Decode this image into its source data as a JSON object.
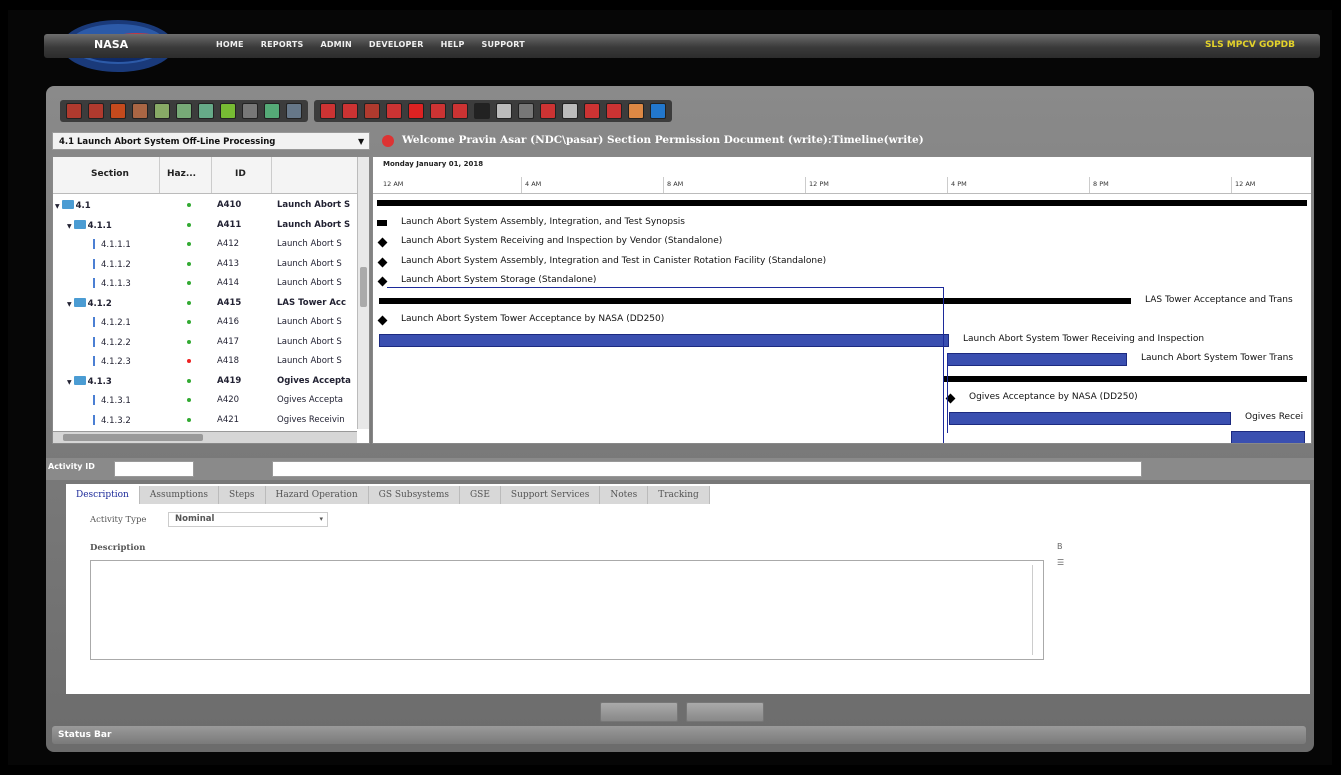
{
  "nav": {
    "logo_text": "NASA",
    "links": [
      "HOME",
      "REPORTS",
      "ADMIN",
      "DEVELOPER",
      "HELP",
      "SUPPORT"
    ],
    "app_title": "SLS MPCV GOPDB"
  },
  "toolbar": {
    "group1": [
      "#b03a2e",
      "#b03a2e",
      "#c44a1d",
      "#a64",
      "#8a6",
      "#7a7",
      "#6a8",
      "#7b3",
      "#777",
      "#5a7",
      "#678"
    ],
    "group2": [
      "#c33",
      "#c33",
      "#b03a2e",
      "#c33",
      "#d22",
      "#c33",
      "#c33",
      "#222",
      "#bbb",
      "#777",
      "#c33",
      "#bbb",
      "#c33",
      "#c33",
      "#d84",
      "#27c"
    ]
  },
  "tree": {
    "document_select": "4.1 Launch Abort System Off-Line Processing",
    "headers": {
      "section": "Section",
      "hazard": "Haz...",
      "id": "ID"
    },
    "rows": [
      {
        "section": "4.1",
        "type": "folder",
        "indent": 0,
        "hazard": "green",
        "id": "A410",
        "name": "Launch Abort S",
        "bold": true
      },
      {
        "section": "4.1.1",
        "type": "folder",
        "indent": 1,
        "hazard": "green",
        "id": "A411",
        "name": "Launch Abort S",
        "bold": true
      },
      {
        "section": "4.1.1.1",
        "type": "leaf",
        "indent": 2,
        "hazard": "green",
        "id": "A412",
        "name": "Launch Abort S",
        "bold": false
      },
      {
        "section": "4.1.1.2",
        "type": "leaf",
        "indent": 2,
        "hazard": "green",
        "id": "A413",
        "name": "Launch Abort S",
        "bold": false
      },
      {
        "section": "4.1.1.3",
        "type": "leaf",
        "indent": 2,
        "hazard": "green",
        "id": "A414",
        "name": "Launch Abort S",
        "bold": false
      },
      {
        "section": "4.1.2",
        "type": "folder",
        "indent": 1,
        "hazard": "green",
        "id": "A415",
        "name": "LAS Tower Acc",
        "bold": true
      },
      {
        "section": "4.1.2.1",
        "type": "leaf",
        "indent": 2,
        "hazard": "green",
        "id": "A416",
        "name": "Launch Abort S",
        "bold": false
      },
      {
        "section": "4.1.2.2",
        "type": "leaf",
        "indent": 2,
        "hazard": "green",
        "id": "A417",
        "name": "Launch Abort S",
        "bold": false
      },
      {
        "section": "4.1.2.3",
        "type": "leaf",
        "indent": 2,
        "hazard": "red",
        "id": "A418",
        "name": "Launch Abort S",
        "bold": false
      },
      {
        "section": "4.1.3",
        "type": "folder",
        "indent": 1,
        "hazard": "green",
        "id": "A419",
        "name": "Ogives Accepta",
        "bold": true
      },
      {
        "section": "4.1.3.1",
        "type": "leaf",
        "indent": 2,
        "hazard": "green",
        "id": "A420",
        "name": "Ogives Accepta",
        "bold": false
      },
      {
        "section": "4.1.3.2",
        "type": "leaf",
        "indent": 2,
        "hazard": "green",
        "id": "A421",
        "name": "Ogives Receivin",
        "bold": false
      }
    ]
  },
  "welcome": "Welcome Pravin Asar (NDC\\pasar)  Section Permission Document (write):Timeline(write)",
  "gantt": {
    "date": "Monday January 01, 2018",
    "ticks": [
      "12 AM",
      "4 AM",
      "8 AM",
      "12 PM",
      "4 PM",
      "8 PM",
      "12 AM"
    ],
    "tasks": [
      {
        "label": "",
        "kind": "summary"
      },
      {
        "label": "Launch Abort System Assembly, Integration, and Test Synopsis",
        "kind": "summary-start"
      },
      {
        "label": "Launch Abort System Receiving and Inspection by Vendor (Standalone)",
        "kind": "milestone"
      },
      {
        "label": "Launch Abort System Assembly, Integration and Test in Canister Rotation Facility (Standalone)",
        "kind": "milestone"
      },
      {
        "label": "Launch Abort System Storage (Standalone)",
        "kind": "milestone"
      },
      {
        "label": "LAS Tower Acceptance and Trans",
        "kind": "summary"
      },
      {
        "label": "Launch Abort System Tower Acceptance by NASA (DD250)",
        "kind": "milestone"
      },
      {
        "label": "Launch Abort System Tower Receiving and Inspection",
        "kind": "bar"
      },
      {
        "label": "Launch Abort System Tower Trans",
        "kind": "bar"
      },
      {
        "label": "",
        "kind": "summary"
      },
      {
        "label": "Ogives Acceptance by NASA (DD250)",
        "kind": "milestone"
      },
      {
        "label": "Ogives Recei",
        "kind": "bar"
      },
      {
        "label": "",
        "kind": "bar"
      }
    ]
  },
  "activity": {
    "label": "Activity ID"
  },
  "tabs": [
    "Description",
    "Assumptions",
    "Steps",
    "Hazard Operation",
    "GS Subsystems",
    "GSE",
    "Support Services",
    "Notes",
    "Tracking"
  ],
  "form": {
    "activity_type_label": "Activity Type",
    "activity_type_value": "Nominal",
    "description_label": "Description"
  },
  "status_bar": "Status Bar"
}
